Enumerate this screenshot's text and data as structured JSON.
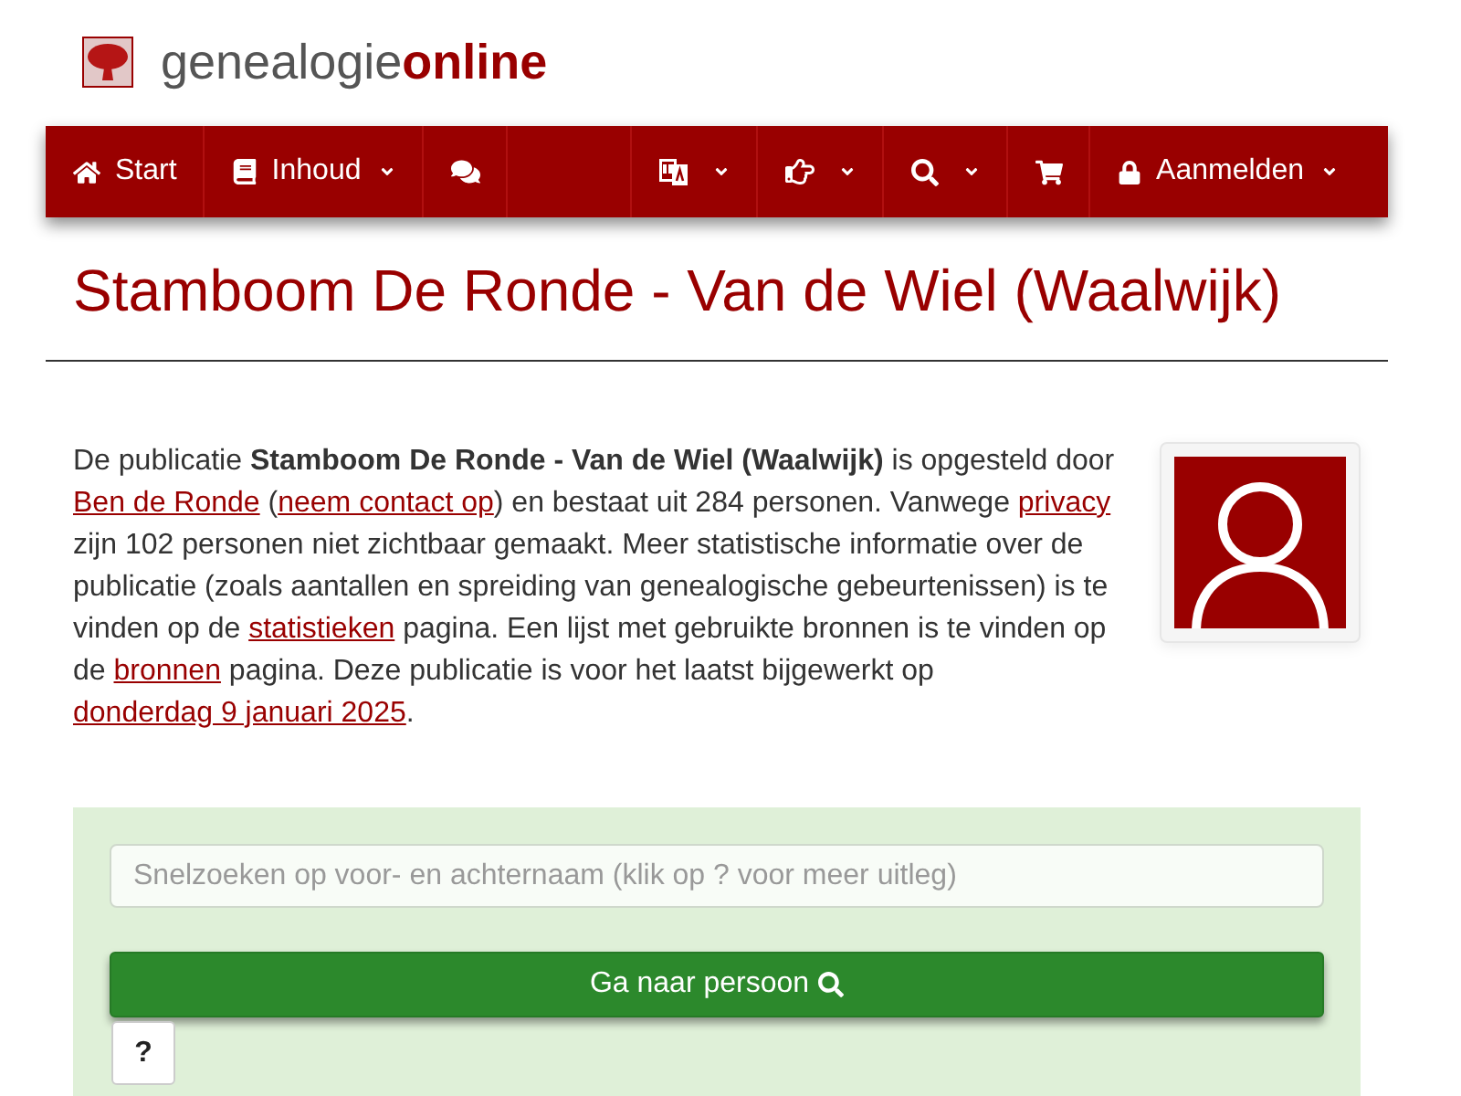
{
  "logo": {
    "text": "genealogie**online**"
  },
  "nav": {
    "left": [
      {
        "label": "Start",
        "dropdown": false
      },
      {
        "label": "Inhoud",
        "dropdown": true
      },
      {
        "dropdown": false
      }
    ],
    "right": [
      {
        "dropdown": true
      },
      {
        "dropdown": true
      },
      {
        "dropdown": true
      },
      {
        "dropdown": false
      },
      {
        "label": "Aanmelden",
        "dropdown": true
      }
    ]
  },
  "title": "Stamboom De Ronde - Van de Wiel (Waalwijk)",
  "description": [
    {
      "kind": "text",
      "text": "De publicatie **Stamboom De Ronde - Van de Wiel (Waalwijk)** is opgesteld door "
    },
    {
      "kind": "link",
      "text": "Ben de Ronde"
    },
    {
      "kind": "text",
      "text": " ("
    },
    {
      "kind": "link",
      "text": "neem contact op"
    },
    {
      "kind": "text",
      "text": ") en bestaat uit 284 personen. Vanwege "
    },
    {
      "kind": "link",
      "text": "privacy"
    },
    {
      "kind": "text",
      "text": " zijn 102 personen niet zichtbaar gemaakt. Meer statistische informatie over de publicatie (zoals aantallen en spreiding van genealogische gebeurtenissen) is te vinden op de "
    },
    {
      "kind": "link",
      "text": "statistieken"
    },
    {
      "kind": "text",
      "text": " pagina. Een lijst met gebruikte bronnen is te vinden op de "
    },
    {
      "kind": "link",
      "text": "bronnen"
    },
    {
      "kind": "text",
      "text": " pagina. Deze publicatie is voor het laatst bijgewerkt op "
    },
    {
      "kind": "link",
      "text": "donderdag 9 januari 2025"
    },
    {
      "kind": "text",
      "text": "."
    }
  ],
  "quick_search": {
    "placeholder": "Snelzoeken op voor- en achternaam (klik op ? voor meer uitleg)",
    "submit": "Ga naar persoon",
    "help": "?"
  }
}
